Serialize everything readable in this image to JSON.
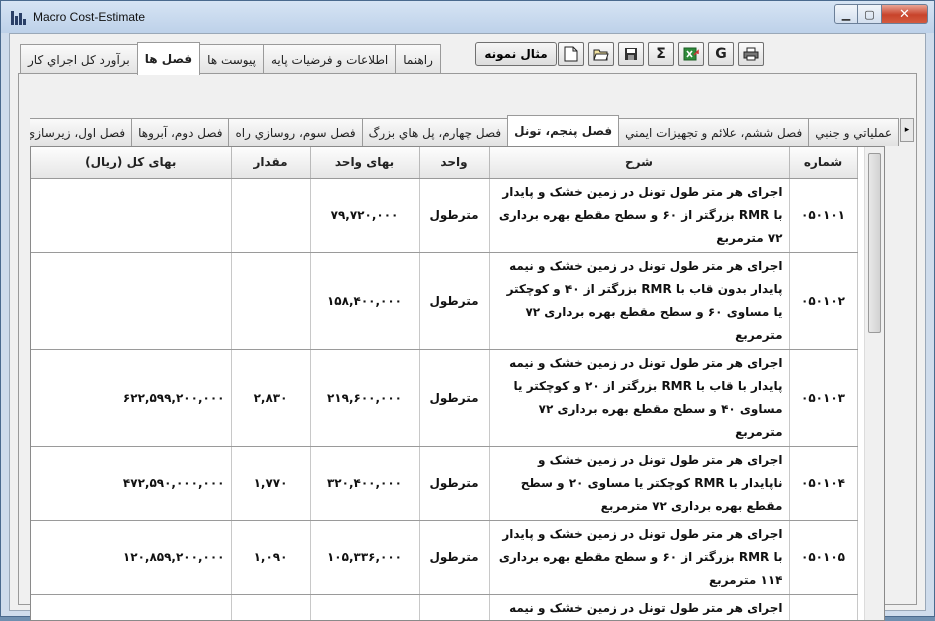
{
  "window": {
    "title": "Macro Cost-Estimate"
  },
  "top_tabs": [
    {
      "label": "راهنما"
    },
    {
      "label": "اطلاعات و فرضيات پايه"
    },
    {
      "label": "پيوست ها"
    },
    {
      "label": "فصل ها",
      "active": true
    },
    {
      "label": "برآورد کل اجراي کار"
    }
  ],
  "toolbar": {
    "sample_label": "مثال نمونه",
    "icons": [
      "new-document-icon",
      "open-folder-icon",
      "save-disk-icon",
      "sigma-sum-icon",
      "excel-export-icon",
      "g-icon",
      "print-icon"
    ],
    "sigma_glyph": "Σ",
    "g_glyph": "G"
  },
  "inner_tabs": [
    {
      "label": "عملياتي و جنبي"
    },
    {
      "label": "فصل ششم، علائم و تجهيزات ايمني"
    },
    {
      "label": "فصل پنجم، تونل",
      "active": true
    },
    {
      "label": "فصل چهارم، پل هاي بزرگ"
    },
    {
      "label": "فصل سوم، روسازي راه"
    },
    {
      "label": "فصل دوم، آبروها"
    },
    {
      "label": "فصل اول، زيرسازي راه"
    }
  ],
  "grid": {
    "headers": {
      "code": "شماره",
      "desc": "شرح",
      "unit": "واحد",
      "unit_price": "بهاى واحد",
      "qty": "مقدار",
      "total": "بهای کل (ریال)"
    },
    "rows": [
      {
        "code": "۰۵۰۱۰۱",
        "desc": "اجرای هر متر طول تونل در زمین خشک و پایدار با RMR بزرگتر از ۶۰ و سطح مقطع بهره برداری ۷۲ مترمربع",
        "unit": "مترطول",
        "unit_price": "۷۹,۷۲۰,۰۰۰",
        "qty": "",
        "total": ""
      },
      {
        "code": "۰۵۰۱۰۲",
        "desc": "اجرای هر متر طول تونل در زمین خشک و نیمه پایدار بدون قاب با RMR بزرگتر از ۴۰ و کوچکتر یا مساوی ۶۰ و سطح مقطع بهره برداری ۷۲ مترمربع",
        "unit": "مترطول",
        "unit_price": "۱۵۸,۴۰۰,۰۰۰",
        "qty": "",
        "total": ""
      },
      {
        "code": "۰۵۰۱۰۳",
        "desc": "اجرای هر متر طول تونل در زمین خشک و نیمه پایدار با قاب با RMR بزرگتر از ۲۰ و کوچکتر یا مساوی ۴۰ و سطح مقطع بهره برداری ۷۲ مترمربع",
        "unit": "مترطول",
        "unit_price": "۲۱۹,۶۰۰,۰۰۰",
        "qty": "۲,۸۳۰",
        "total": "۶۲۲,۵۹۹,۲۰۰,۰۰۰"
      },
      {
        "code": "۰۵۰۱۰۴",
        "desc": "اجرای هر متر طول تونل در زمین خشک و ناپایدار با RMR کوچکتر یا مساوی ۲۰ و سطح مقطع بهره برداری ۷۲ مترمربع",
        "unit": "مترطول",
        "unit_price": "۳۲۰,۴۰۰,۰۰۰",
        "qty": "۱,۷۷۰",
        "total": "۴۷۲,۵۹۰,۰۰۰,۰۰۰"
      },
      {
        "code": "۰۵۰۱۰۵",
        "desc": "اجرای هر متر طول تونل در زمین خشک و پایدار با RMR بزرگتر از ۶۰ و سطح مقطع بهره برداری ۱۱۴ مترمربع",
        "unit": "مترطول",
        "unit_price": "۱۰۵,۳۳۶,۰۰۰",
        "qty": "۱,۰۹۰",
        "total": "۱۲۰,۸۵۹,۲۰۰,۰۰۰"
      },
      {
        "code": "",
        "desc": "اجرای هر متر طول تونل در زمین خشک و نیمه",
        "unit": "",
        "unit_price": "",
        "qty": "",
        "total": ""
      }
    ]
  }
}
